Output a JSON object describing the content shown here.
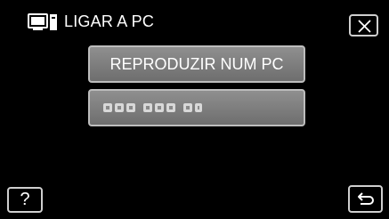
{
  "header": {
    "title": "LIGAR A PC",
    "icon": "pc-connection-icon"
  },
  "menu": {
    "items": [
      {
        "label": "REPRODUZIR NUM PC"
      }
    ],
    "obscured_item_icon": "pixelated-text-icon"
  },
  "controls": {
    "close_icon": "close-icon",
    "help_label": "?",
    "back_icon": "back-arrow-icon"
  },
  "colors": {
    "background": "#000000",
    "button_fill_top": "#8f8f8f",
    "button_fill_bottom": "#6e6e6e",
    "button_border": "#bdbdbd",
    "text": "#ffffff"
  }
}
